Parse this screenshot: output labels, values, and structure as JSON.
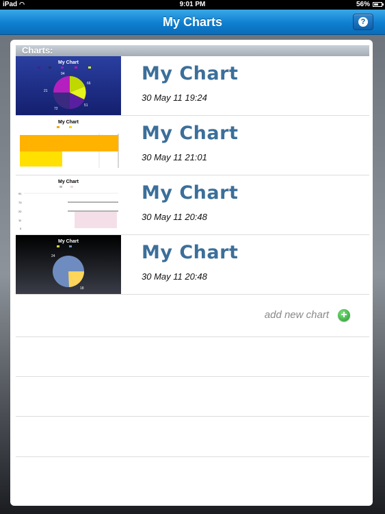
{
  "status_bar": {
    "device": "iPad",
    "time": "9:01 PM",
    "battery": "56%"
  },
  "nav": {
    "title": "My Charts",
    "help_icon": "?"
  },
  "section": {
    "header": "Charts:"
  },
  "charts": [
    {
      "title": "My Chart",
      "date": "30 May 11 19:24",
      "thumb": {
        "title": "My Chart",
        "labels": [
          "94",
          "66",
          "51",
          "72",
          "21"
        ]
      }
    },
    {
      "title": "My Chart",
      "date": "30 May 11 21:01",
      "thumb": {
        "title": "My Chart"
      }
    },
    {
      "title": "My Chart",
      "date": "30 May 11 20:48",
      "thumb": {
        "title": "My Chart",
        "labels": [
          "91",
          "73",
          "22",
          "11",
          "0"
        ]
      }
    },
    {
      "title": "My Chart",
      "date": "30 May 11 20:48",
      "thumb": {
        "title": "My Chart",
        "labels": [
          "24",
          "18"
        ]
      }
    }
  ],
  "add_chart": {
    "label": "add new chart",
    "icon": "+"
  },
  "colors": {
    "nav_blue": "#0e7fd0",
    "title_blue": "#3c6f9a",
    "add_green": "#1f9a2a"
  }
}
